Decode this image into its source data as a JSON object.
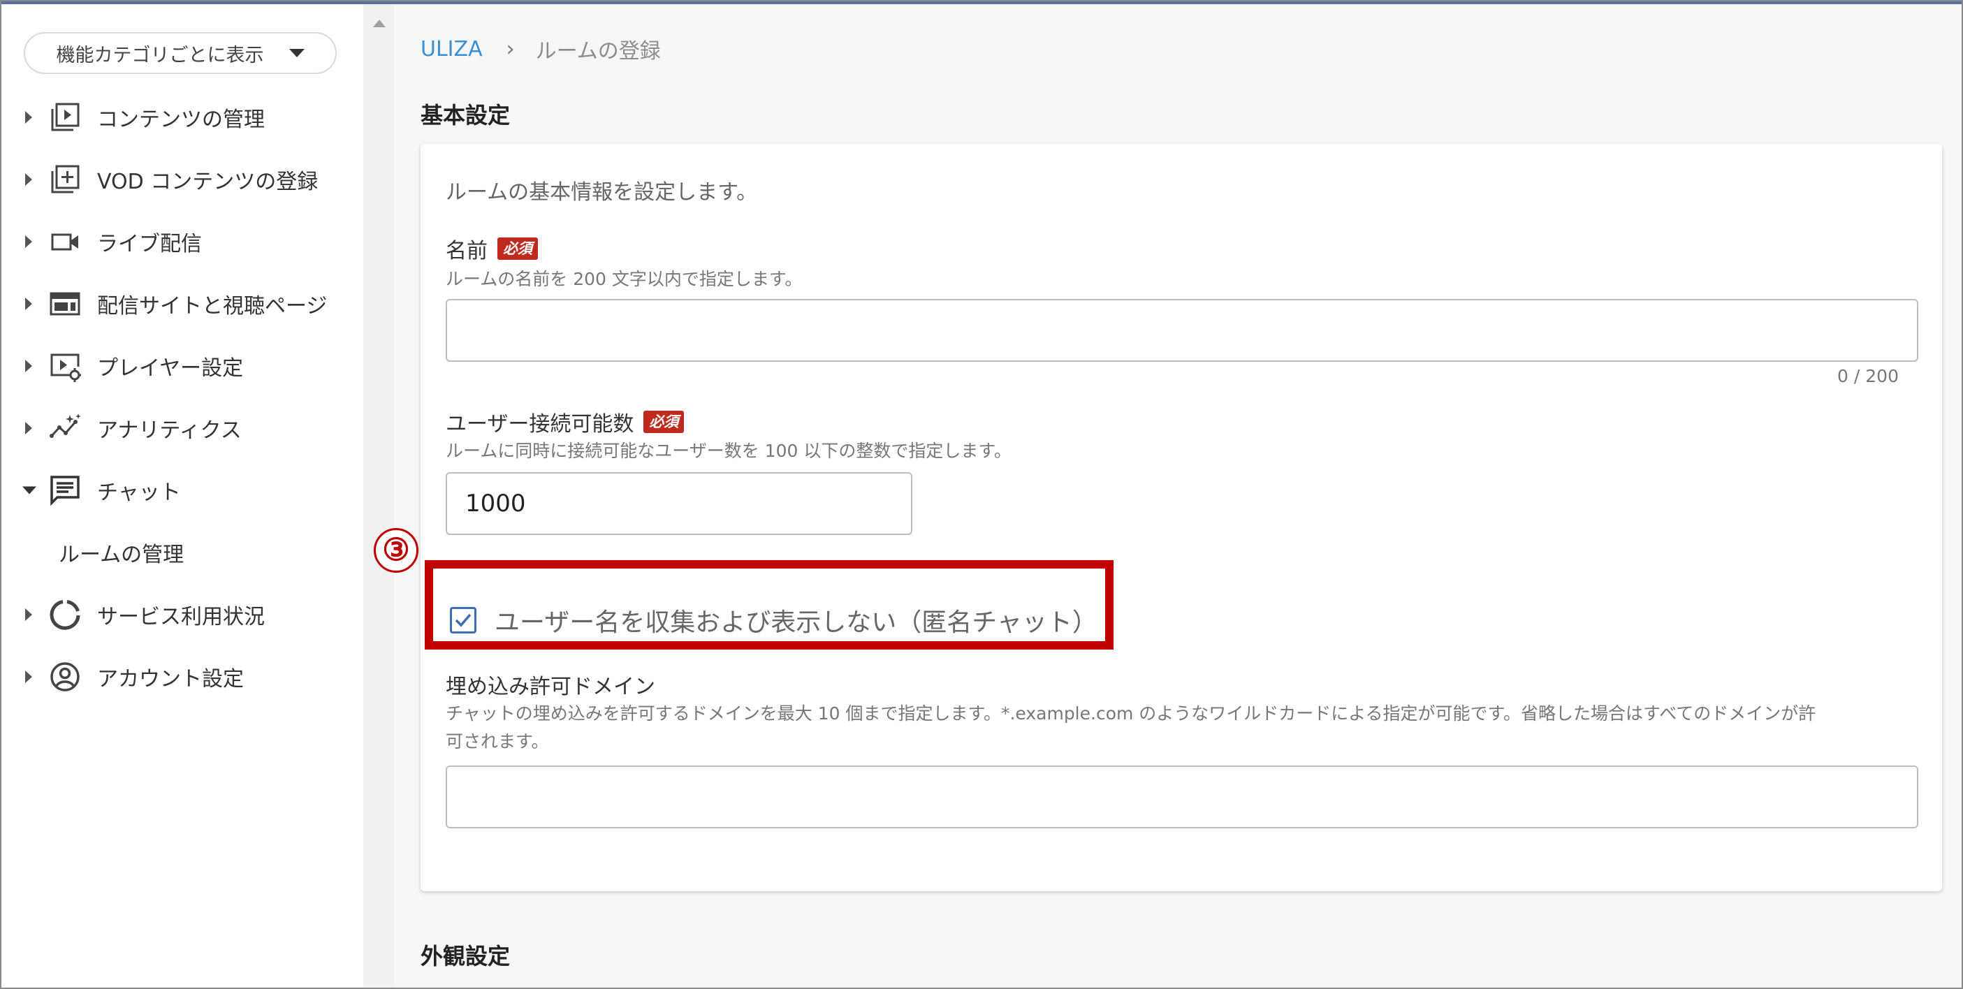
{
  "sidebar": {
    "category_select": "機能カテゴリごとに表示",
    "items": [
      {
        "label": "コンテンツの管理",
        "icon": "play-library-icon"
      },
      {
        "label": "VOD コンテンツの登録",
        "icon": "add-library-icon"
      },
      {
        "label": "ライブ配信",
        "icon": "videocam-icon"
      },
      {
        "label": "配信サイトと視聴ページ",
        "icon": "web-layout-icon"
      },
      {
        "label": "プレイヤー設定",
        "icon": "player-settings-icon"
      },
      {
        "label": "アナリティクス",
        "icon": "analytics-icon"
      },
      {
        "label": "チャット",
        "icon": "chat-icon",
        "expanded": true
      },
      {
        "label": "サービス利用状況",
        "icon": "usage-ring-icon"
      },
      {
        "label": "アカウント設定",
        "icon": "account-circle-icon"
      }
    ],
    "chat_sub": "ルームの管理"
  },
  "breadcrumb": {
    "root": "ULIZA",
    "separator": "›",
    "current": "ルームの登録"
  },
  "basic": {
    "title": "基本設定",
    "description": "ルームの基本情報を設定します。",
    "name": {
      "label": "名前",
      "required": "必須",
      "help": "ルームの名前を 200 文字以内で指定します。",
      "value": "",
      "counter": "0 / 200"
    },
    "users": {
      "label": "ユーザー接続可能数",
      "required": "必須",
      "help": "ルームに同時に接続可能なユーザー数を 100 以下の整数で指定します。",
      "value": "1000"
    },
    "anonymous": {
      "label": "ユーザー名を収集および表示しない（匿名チャット）",
      "checked": true
    },
    "domains": {
      "label": "埋め込み許可ドメイン",
      "help_line1": "チャットの埋め込みを許可するドメインを最大 10 個まで指定します。*.example.com のようなワイルドカードによる指定が可能です。省略した場合はすべてのドメインが許",
      "help_line2": "可されます。",
      "value": ""
    }
  },
  "appearance": {
    "title": "外観設定"
  },
  "annotation": {
    "step": "③",
    "color": "#c00000"
  },
  "colors": {
    "link": "#3a8fd4",
    "required_badge": "#c0291d",
    "checkbox": "#3b6fb6"
  }
}
